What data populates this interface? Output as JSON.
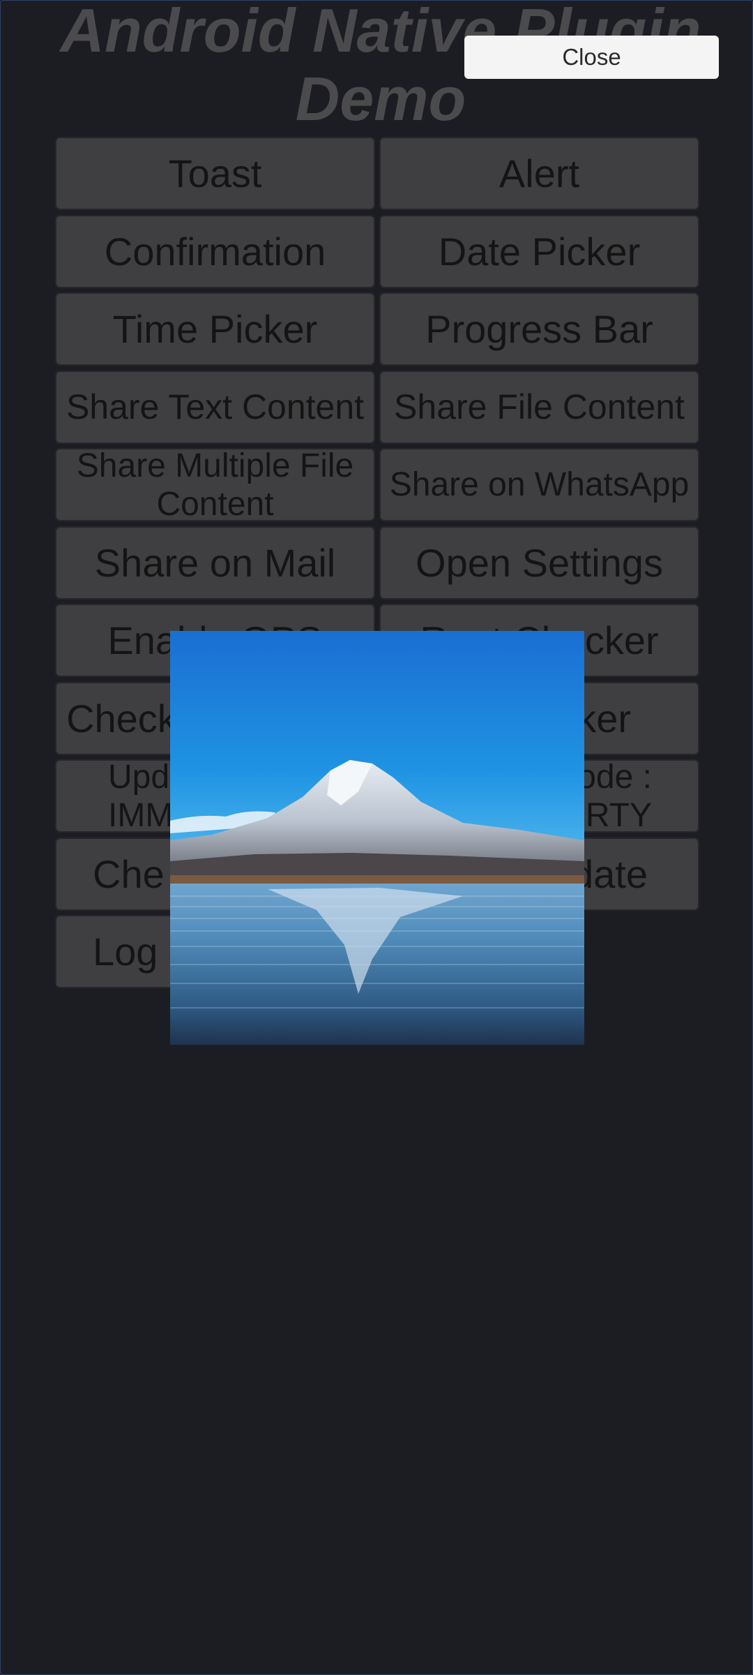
{
  "app": {
    "title": "Android Native Plugin\nDemo"
  },
  "close_button": {
    "label": "Close"
  },
  "buttons": [
    {
      "name": "toast-button",
      "label": "Toast"
    },
    {
      "name": "alert-button",
      "label": "Alert"
    },
    {
      "name": "confirmation-button",
      "label": "Confirmation"
    },
    {
      "name": "date-picker-button",
      "label": "Date Picker"
    },
    {
      "name": "time-picker-button",
      "label": "Time Picker"
    },
    {
      "name": "progress-bar-button",
      "label": "Progress Bar"
    },
    {
      "name": "share-text-content-button",
      "label": "Share Text Content"
    },
    {
      "name": "share-file-content-button",
      "label": "Share File Content"
    },
    {
      "name": "share-multiple-file-content-button",
      "label": "Share Multiple File Content"
    },
    {
      "name": "share-on-whatsapp-button",
      "label": "Share on WhatsApp"
    },
    {
      "name": "share-on-mail-button",
      "label": "Share on Mail"
    },
    {
      "name": "open-settings-button",
      "label": "Open Settings"
    },
    {
      "name": "enable-gps-button",
      "label": "Enable GPS"
    },
    {
      "name": "root-checker-button",
      "label": "Root Checker"
    },
    {
      "name": "check-button",
      "label": "Check"
    },
    {
      "name": "picker-button",
      "label": "ker"
    },
    {
      "name": "update-immediate-button",
      "label": "Upd\nIMM"
    },
    {
      "name": "update-mode-flexible-button",
      "label": "ode :\nRTY"
    },
    {
      "name": "check-update-button",
      "label": "Che"
    },
    {
      "name": "update-button",
      "label": "date"
    },
    {
      "name": "log-button",
      "label": "Log"
    }
  ],
  "overlay_image": {
    "description_icon": "mountain-lake-image"
  },
  "colors": {
    "background": "#1c1d23",
    "button": "#3f3f41",
    "close_button": "#f4f4f4",
    "title": "#4b4b4d"
  }
}
